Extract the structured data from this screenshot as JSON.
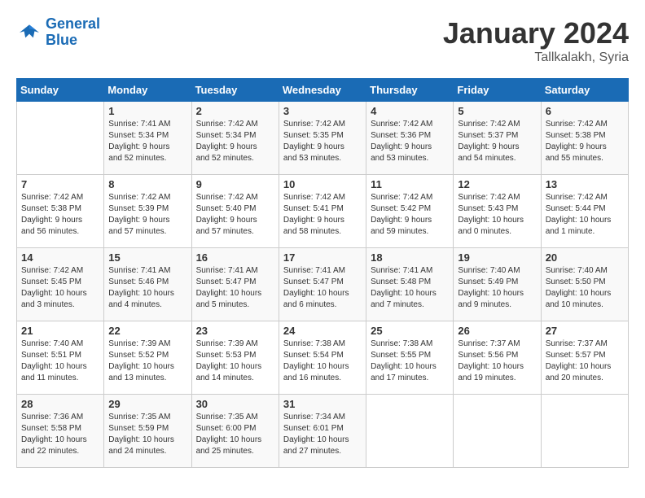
{
  "logo": {
    "line1": "General",
    "line2": "Blue"
  },
  "title": "January 2024",
  "subtitle": "Tallkalakh, Syria",
  "days_of_week": [
    "Sunday",
    "Monday",
    "Tuesday",
    "Wednesday",
    "Thursday",
    "Friday",
    "Saturday"
  ],
  "weeks": [
    [
      {
        "day": "",
        "info": ""
      },
      {
        "day": "1",
        "info": "Sunrise: 7:41 AM\nSunset: 5:34 PM\nDaylight: 9 hours\nand 52 minutes."
      },
      {
        "day": "2",
        "info": "Sunrise: 7:42 AM\nSunset: 5:34 PM\nDaylight: 9 hours\nand 52 minutes."
      },
      {
        "day": "3",
        "info": "Sunrise: 7:42 AM\nSunset: 5:35 PM\nDaylight: 9 hours\nand 53 minutes."
      },
      {
        "day": "4",
        "info": "Sunrise: 7:42 AM\nSunset: 5:36 PM\nDaylight: 9 hours\nand 53 minutes."
      },
      {
        "day": "5",
        "info": "Sunrise: 7:42 AM\nSunset: 5:37 PM\nDaylight: 9 hours\nand 54 minutes."
      },
      {
        "day": "6",
        "info": "Sunrise: 7:42 AM\nSunset: 5:38 PM\nDaylight: 9 hours\nand 55 minutes."
      }
    ],
    [
      {
        "day": "7",
        "info": "Sunrise: 7:42 AM\nSunset: 5:38 PM\nDaylight: 9 hours\nand 56 minutes."
      },
      {
        "day": "8",
        "info": "Sunrise: 7:42 AM\nSunset: 5:39 PM\nDaylight: 9 hours\nand 57 minutes."
      },
      {
        "day": "9",
        "info": "Sunrise: 7:42 AM\nSunset: 5:40 PM\nDaylight: 9 hours\nand 57 minutes."
      },
      {
        "day": "10",
        "info": "Sunrise: 7:42 AM\nSunset: 5:41 PM\nDaylight: 9 hours\nand 58 minutes."
      },
      {
        "day": "11",
        "info": "Sunrise: 7:42 AM\nSunset: 5:42 PM\nDaylight: 9 hours\nand 59 minutes."
      },
      {
        "day": "12",
        "info": "Sunrise: 7:42 AM\nSunset: 5:43 PM\nDaylight: 10 hours\nand 0 minutes."
      },
      {
        "day": "13",
        "info": "Sunrise: 7:42 AM\nSunset: 5:44 PM\nDaylight: 10 hours\nand 1 minute."
      }
    ],
    [
      {
        "day": "14",
        "info": "Sunrise: 7:42 AM\nSunset: 5:45 PM\nDaylight: 10 hours\nand 3 minutes."
      },
      {
        "day": "15",
        "info": "Sunrise: 7:41 AM\nSunset: 5:46 PM\nDaylight: 10 hours\nand 4 minutes."
      },
      {
        "day": "16",
        "info": "Sunrise: 7:41 AM\nSunset: 5:47 PM\nDaylight: 10 hours\nand 5 minutes."
      },
      {
        "day": "17",
        "info": "Sunrise: 7:41 AM\nSunset: 5:47 PM\nDaylight: 10 hours\nand 6 minutes."
      },
      {
        "day": "18",
        "info": "Sunrise: 7:41 AM\nSunset: 5:48 PM\nDaylight: 10 hours\nand 7 minutes."
      },
      {
        "day": "19",
        "info": "Sunrise: 7:40 AM\nSunset: 5:49 PM\nDaylight: 10 hours\nand 9 minutes."
      },
      {
        "day": "20",
        "info": "Sunrise: 7:40 AM\nSunset: 5:50 PM\nDaylight: 10 hours\nand 10 minutes."
      }
    ],
    [
      {
        "day": "21",
        "info": "Sunrise: 7:40 AM\nSunset: 5:51 PM\nDaylight: 10 hours\nand 11 minutes."
      },
      {
        "day": "22",
        "info": "Sunrise: 7:39 AM\nSunset: 5:52 PM\nDaylight: 10 hours\nand 13 minutes."
      },
      {
        "day": "23",
        "info": "Sunrise: 7:39 AM\nSunset: 5:53 PM\nDaylight: 10 hours\nand 14 minutes."
      },
      {
        "day": "24",
        "info": "Sunrise: 7:38 AM\nSunset: 5:54 PM\nDaylight: 10 hours\nand 16 minutes."
      },
      {
        "day": "25",
        "info": "Sunrise: 7:38 AM\nSunset: 5:55 PM\nDaylight: 10 hours\nand 17 minutes."
      },
      {
        "day": "26",
        "info": "Sunrise: 7:37 AM\nSunset: 5:56 PM\nDaylight: 10 hours\nand 19 minutes."
      },
      {
        "day": "27",
        "info": "Sunrise: 7:37 AM\nSunset: 5:57 PM\nDaylight: 10 hours\nand 20 minutes."
      }
    ],
    [
      {
        "day": "28",
        "info": "Sunrise: 7:36 AM\nSunset: 5:58 PM\nDaylight: 10 hours\nand 22 minutes."
      },
      {
        "day": "29",
        "info": "Sunrise: 7:35 AM\nSunset: 5:59 PM\nDaylight: 10 hours\nand 24 minutes."
      },
      {
        "day": "30",
        "info": "Sunrise: 7:35 AM\nSunset: 6:00 PM\nDaylight: 10 hours\nand 25 minutes."
      },
      {
        "day": "31",
        "info": "Sunrise: 7:34 AM\nSunset: 6:01 PM\nDaylight: 10 hours\nand 27 minutes."
      },
      {
        "day": "",
        "info": ""
      },
      {
        "day": "",
        "info": ""
      },
      {
        "day": "",
        "info": ""
      }
    ]
  ]
}
